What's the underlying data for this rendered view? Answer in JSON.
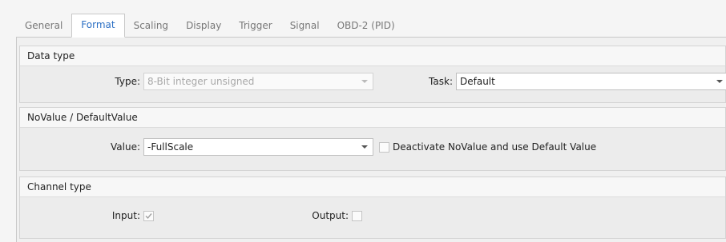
{
  "tabs": [
    {
      "label": "General"
    },
    {
      "label": "Format",
      "active": true
    },
    {
      "label": "Scaling"
    },
    {
      "label": "Display"
    },
    {
      "label": "Trigger"
    },
    {
      "label": "Signal"
    },
    {
      "label": "OBD-2 (PID)"
    }
  ],
  "data_type": {
    "title": "Data type",
    "type_label": "Type:",
    "type_value": "8-Bit integer unsigned",
    "task_label": "Task:",
    "task_value": "Default"
  },
  "novalue": {
    "title": "NoValue / DefaultValue",
    "value_label": "Value:",
    "value_value": "-FullScale",
    "deactivate_label": "Deactivate NoValue and use Default Value",
    "deactivate_checked": false
  },
  "channel_type": {
    "title": "Channel type",
    "input_label": "Input:",
    "input_checked": true,
    "output_label": "Output:",
    "output_checked": false
  },
  "colors": {
    "active_tab": "#2b6fc4",
    "disabled_text": "#a8a8a8"
  },
  "icons": {
    "dropdown": "chevron-down-icon",
    "check": "check-icon"
  }
}
